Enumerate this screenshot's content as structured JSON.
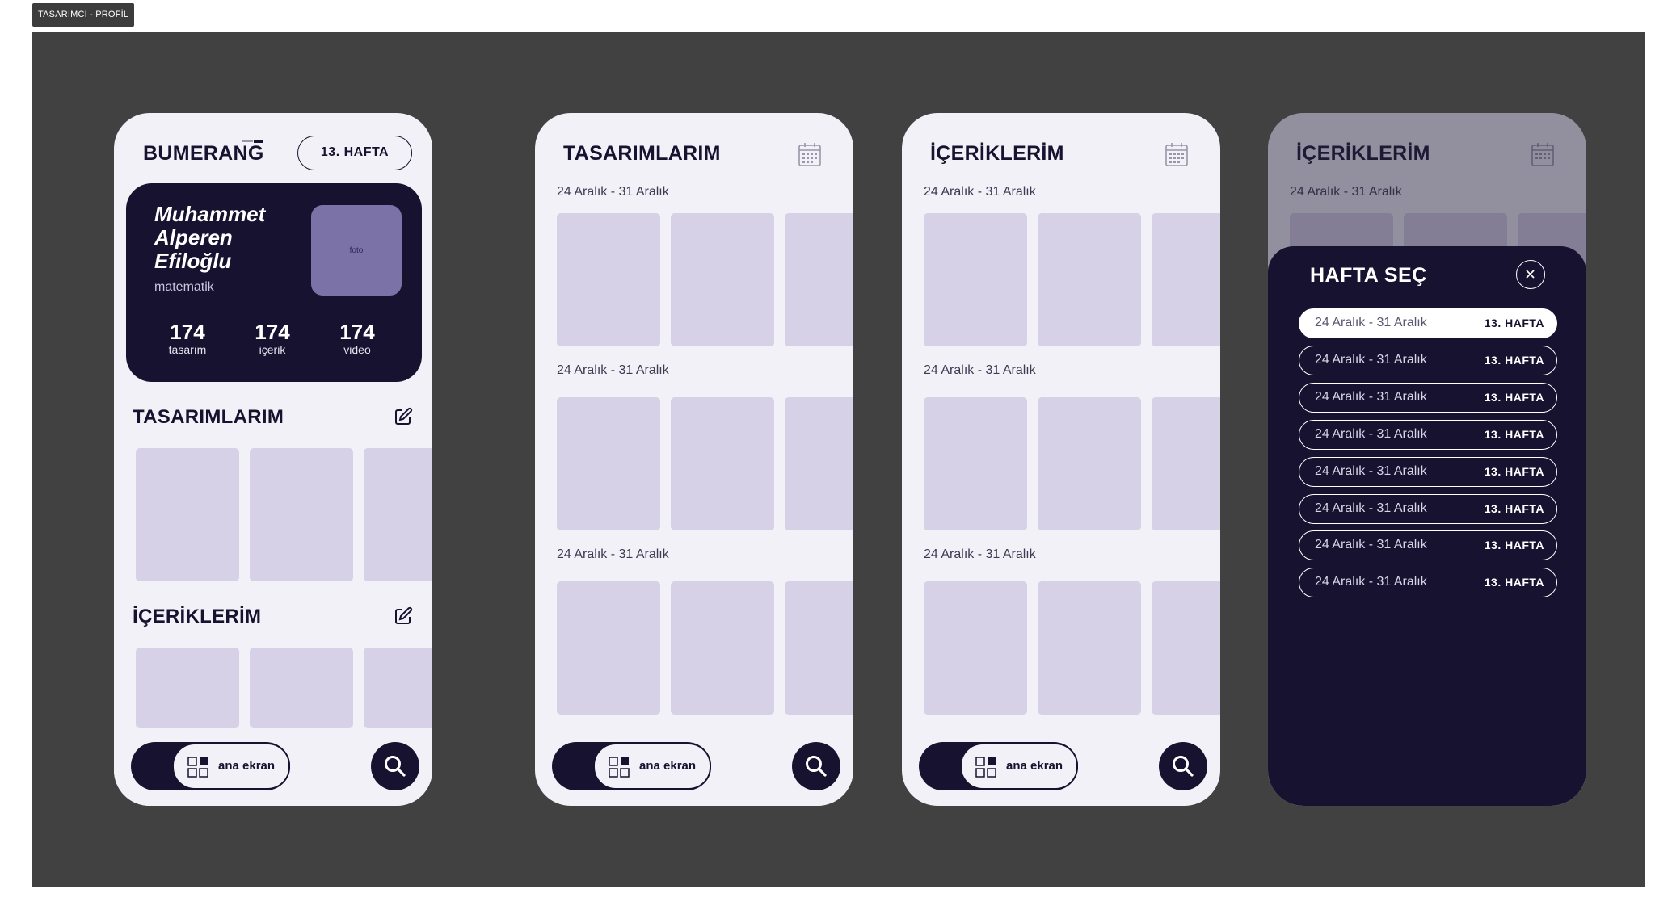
{
  "frame_label": "TASARIMCI - PROFİL",
  "brand": {
    "name": "BUMERANG"
  },
  "profile": {
    "week_button": "13. HAFTA",
    "name": "Muhammet Alperen Efiloğlu",
    "department": "matematik",
    "photo_placeholder": "foto",
    "stats": [
      {
        "value": "174",
        "label": "tasarım"
      },
      {
        "value": "174",
        "label": "içerik"
      },
      {
        "value": "174",
        "label": "video"
      }
    ],
    "sections": {
      "designs_title": "TASARIMLARIM",
      "contents_title": "İÇERİKLERİM"
    }
  },
  "designs_screen": {
    "title": "TASARIMLARIM",
    "groups": [
      {
        "date_range": "24 Aralık - 31 Aralık"
      },
      {
        "date_range": "24 Aralık - 31 Aralık"
      },
      {
        "date_range": "24 Aralık - 31 Aralık"
      }
    ]
  },
  "contents_screen": {
    "title": "İÇERİKLERİM",
    "groups": [
      {
        "date_range": "24 Aralık - 31 Aralık"
      },
      {
        "date_range": "24 Aralık - 31 Aralık"
      },
      {
        "date_range": "24 Aralık - 31 Aralık"
      }
    ]
  },
  "week_picker_screen": {
    "background_title": "İÇERİKLERİM",
    "background_date": "24 Aralık - 31 Aralık",
    "sheet_title": "HAFTA SEÇ",
    "weeks": [
      {
        "date_range": "24 Aralık - 31 Aralık",
        "week": "13. HAFTA",
        "selected": true
      },
      {
        "date_range": "24 Aralık - 31 Aralık",
        "week": "13. HAFTA",
        "selected": false
      },
      {
        "date_range": "24 Aralık - 31 Aralık",
        "week": "13. HAFTA",
        "selected": false
      },
      {
        "date_range": "24 Aralık - 31 Aralık",
        "week": "13. HAFTA",
        "selected": false
      },
      {
        "date_range": "24 Aralık - 31 Aralık",
        "week": "13. HAFTA",
        "selected": false
      },
      {
        "date_range": "24 Aralık - 31 Aralık",
        "week": "13. HAFTA",
        "selected": false
      },
      {
        "date_range": "24 Aralık - 31 Aralık",
        "week": "13. HAFTA",
        "selected": false
      },
      {
        "date_range": "24 Aralık - 31 Aralık",
        "week": "13. HAFTA",
        "selected": false
      }
    ]
  },
  "nav": {
    "home_label": "ana ekran",
    "home_icon": "grid-icon",
    "search_icon": "search-icon"
  },
  "colors": {
    "primary": "#16122f",
    "canvas": "#414141",
    "screen_bg": "#f3f1f8",
    "tile": "#d6d1e6",
    "photo": "#7b72a8"
  }
}
